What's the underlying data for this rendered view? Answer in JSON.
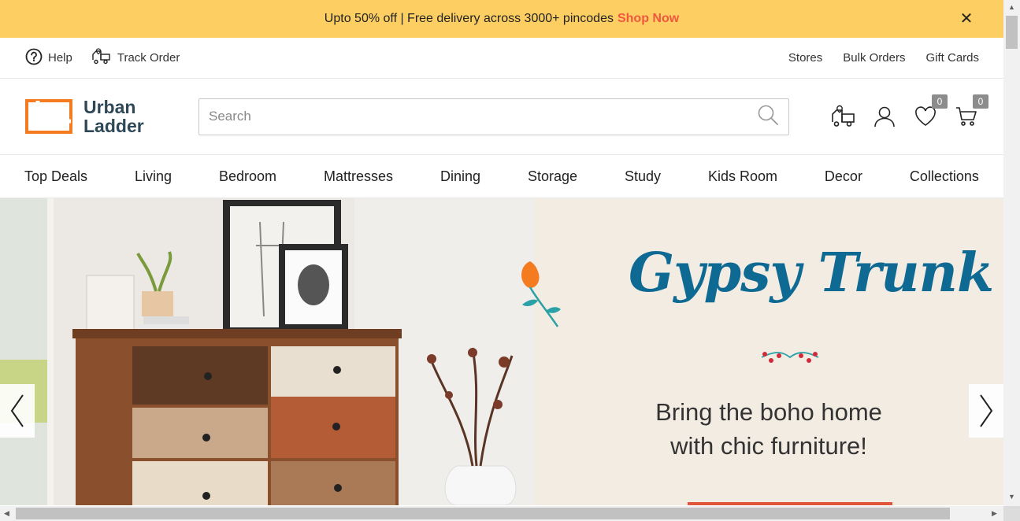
{
  "promo": {
    "text": "Upto 50% off | Free delivery across 3000+ pincodes",
    "link": "Shop Now",
    "close": "✕"
  },
  "util": {
    "help": "Help",
    "track": "Track Order",
    "right": [
      "Stores",
      "Bulk Orders",
      "Gift Cards"
    ]
  },
  "logo": {
    "line1": "Urban",
    "line2": "Ladder"
  },
  "search": {
    "placeholder": "Search"
  },
  "icons": {
    "wishlist_count": "0",
    "cart_count": "0"
  },
  "nav": [
    "Top Deals",
    "Living",
    "Bedroom",
    "Mattresses",
    "Dining",
    "Storage",
    "Study",
    "Kids Room",
    "Decor",
    "Collections"
  ],
  "hero": {
    "brand": "Gypsy Trunk",
    "tagline1": "Bring the boho home",
    "tagline2": "with chic furniture!"
  },
  "colors": {
    "promo_bg": "#fdcf63",
    "accent": "#f1573f",
    "logo_orange": "#f47b20",
    "logo_text": "#2f4858",
    "brand_blue": "#0e6a93"
  }
}
